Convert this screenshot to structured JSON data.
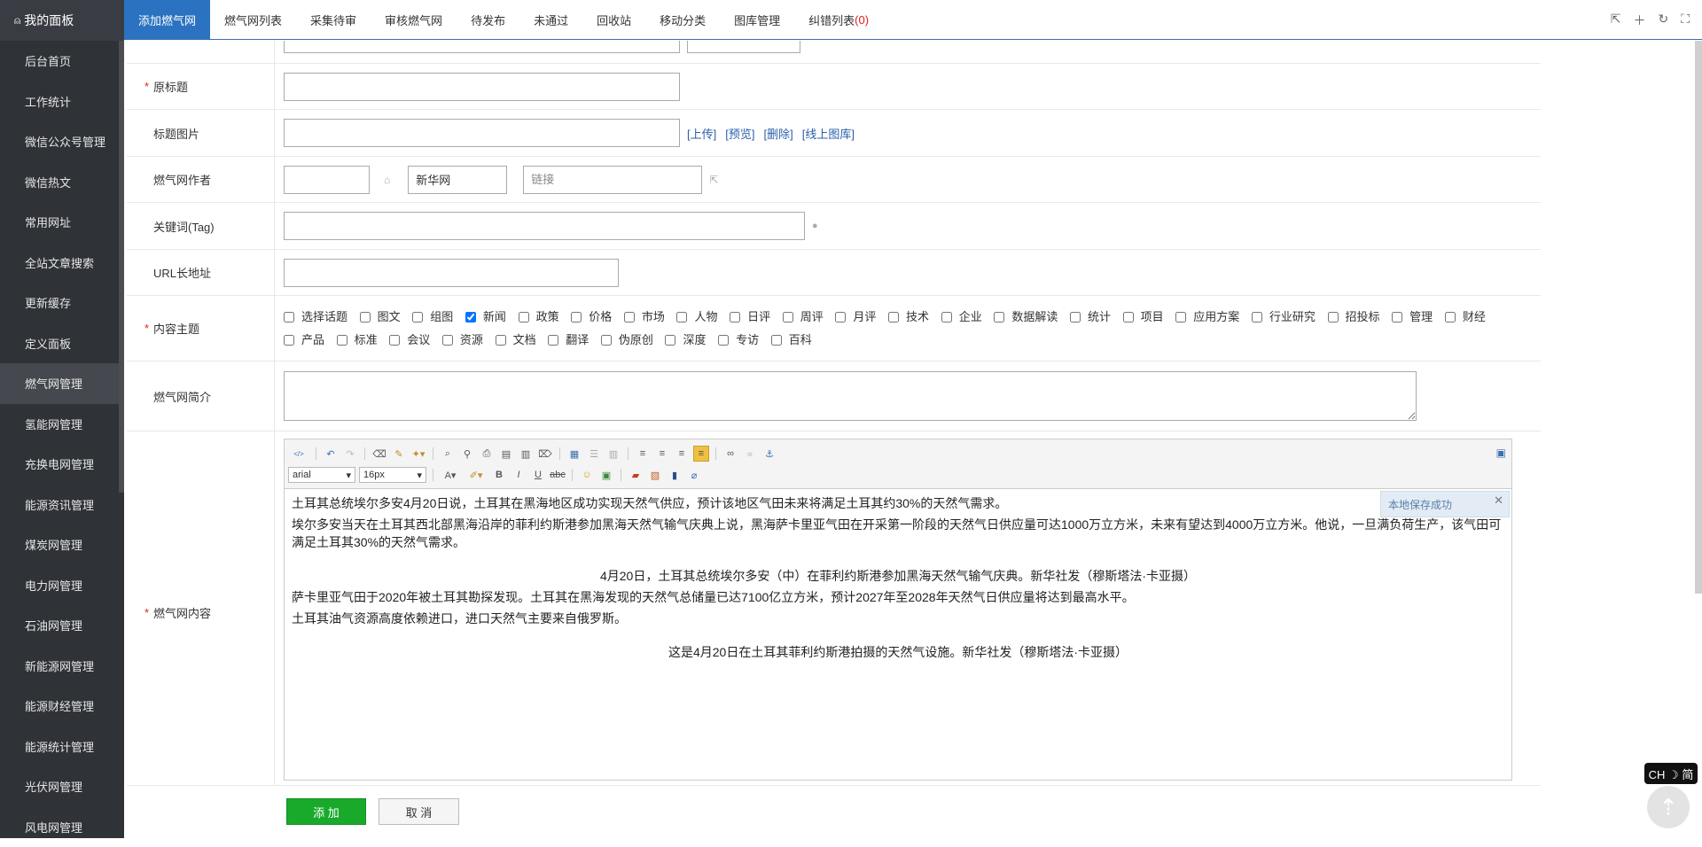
{
  "sidebar": {
    "brand": "我的面板",
    "items": [
      "后台首页",
      "工作统计",
      "微信公众号管理",
      "微信热文",
      "常用网址",
      "全站文章搜索",
      "更新缓存",
      "定义面板",
      "燃气网管理",
      "氢能网管理",
      "充换电网管理",
      "能源资讯管理",
      "煤炭网管理",
      "电力网管理",
      "石油网管理",
      "新能源网管理",
      "能源财经管理",
      "能源统计管理",
      "光伏网管理",
      "风电网管理"
    ]
  },
  "tabs": {
    "t0": "添加燃气网",
    "t1": "燃气网列表",
    "t2": "采集待审",
    "t3": "审核燃气网",
    "t4": "待发布",
    "t5": "未通过",
    "t6": "回收站",
    "t7": "移动分类",
    "t8": "图库管理",
    "t9": "纠错列表",
    "t9_count": "(0)"
  },
  "form": {
    "original_title_label": "原标题",
    "title_image_label": "标题图片",
    "upload": "[上传]",
    "preview": "[预览]",
    "delete": "[删除]",
    "online_gallery": "[线上图库]",
    "author_label": "燃气网作者",
    "source_value": "新华网",
    "link_placeholder": "链接",
    "keywords_label": "关键词(Tag)",
    "url_label": "URL长地址",
    "topic_label": "内容主题",
    "topics": [
      "选择话题",
      "图文",
      "组图",
      "新闻",
      "政策",
      "价格",
      "市场",
      "人物",
      "日评",
      "周评",
      "月评",
      "技术",
      "企业",
      "数据解读",
      "统计",
      "项目",
      "应用方案",
      "行业研究",
      "招投标",
      "管理",
      "财经",
      "产品",
      "标准",
      "会议",
      "资源",
      "文档",
      "翻译",
      "伪原创",
      "深度",
      "专访",
      "百科"
    ],
    "intro_label": "燃气网简介",
    "content_label": "燃气网内容"
  },
  "editor": {
    "font": "arial",
    "size": "16px",
    "p1": "土耳其总统埃尔多安4月20日说，土耳其在黑海地区成功实现天然气供应，预计该地区气田未来将满足土耳其约30%的天然气需求。",
    "p2": "埃尔多安当天在土耳其西北部黑海沿岸的菲利约斯港参加黑海天然气输气庆典上说，黑海萨卡里亚气田在开采第一阶段的天然气日供应量可达1000万立方米，未来有望达到4000万立方米。他说，一旦满负荷生产，该气田可满足土耳其30%的天然气需求。",
    "cap1": "4月20日，土耳其总统埃尔多安（中）在菲利约斯港参加黑海天然气输气庆典。新华社发（穆斯塔法·卡亚摄）",
    "p3": "萨卡里亚气田于2020年被土耳其勘探发现。土耳其在黑海发现的天然气总储量已达7100亿立方米，预计2027年至2028年天然气日供应量将达到最高水平。",
    "p4": "土耳其油气资源高度依赖进口，进口天然气主要来自俄罗斯。",
    "cap2": "这是4月20日在土耳其菲利约斯港拍摄的天然气设施。新华社发（穆斯塔法·卡亚摄）",
    "toast": "本地保存成功"
  },
  "actions": {
    "add": "添 加",
    "cancel": "取 消"
  },
  "ime": "CH ☽ 简"
}
